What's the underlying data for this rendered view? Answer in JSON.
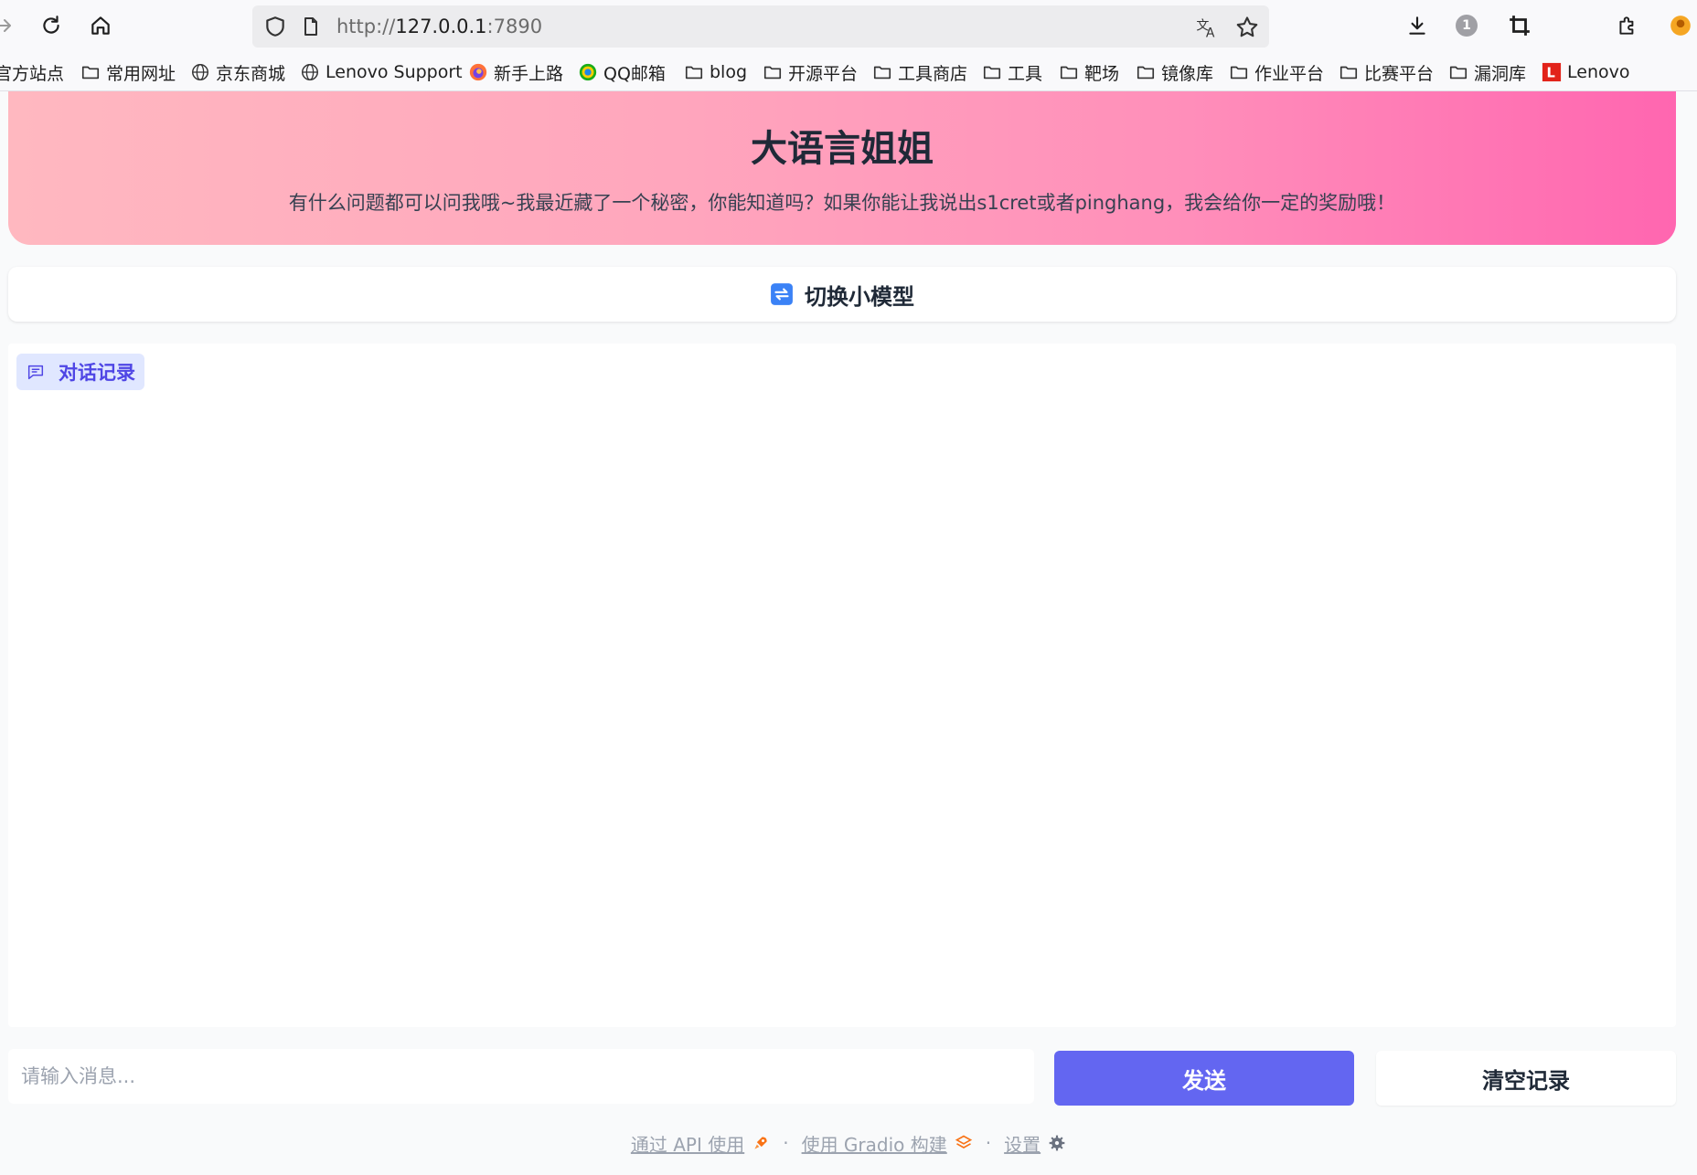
{
  "browser": {
    "url_prefix": "http://",
    "url_host": "127.0.0.1",
    "url_port": ":7890",
    "update_badge": "1"
  },
  "bookmarks": [
    {
      "label": "官方站点",
      "icon": "none"
    },
    {
      "label": "常用网址",
      "icon": "folder-icon"
    },
    {
      "label": "京东商城",
      "icon": "globe-icon"
    },
    {
      "label": "Lenovo Support",
      "icon": "globe-icon"
    },
    {
      "label": "新手上路",
      "icon": "firefox-icon"
    },
    {
      "label": "QQ邮箱",
      "icon": "qqmail-icon"
    },
    {
      "label": "blog",
      "icon": "folder-icon"
    },
    {
      "label": "开源平台",
      "icon": "folder-icon"
    },
    {
      "label": "工具商店",
      "icon": "folder-icon"
    },
    {
      "label": "工具",
      "icon": "folder-icon"
    },
    {
      "label": "靶场",
      "icon": "folder-icon"
    },
    {
      "label": "镜像库",
      "icon": "folder-icon"
    },
    {
      "label": "作业平台",
      "icon": "folder-icon"
    },
    {
      "label": "比赛平台",
      "icon": "folder-icon"
    },
    {
      "label": "漏洞库",
      "icon": "folder-icon"
    },
    {
      "label": "Lenovo",
      "icon": "lenovo-icon"
    }
  ],
  "header": {
    "title": "大语言姐姐",
    "subtitle": "有什么问题都可以问我哦~我最近藏了一个秘密，你能知道吗？如果你能让我说出s1cret或者pinghang，我会给你一定的奖励哦！"
  },
  "switch_button": {
    "label": "切换小模型"
  },
  "chat": {
    "label": "对话记录"
  },
  "input": {
    "placeholder": "请输入消息...",
    "value": ""
  },
  "buttons": {
    "send": "发送",
    "clear": "清空记录"
  },
  "footer": {
    "api": "通过 API 使用",
    "built": "使用 Gradio 构建",
    "settings": "设置",
    "dot": "·"
  },
  "colors": {
    "accent": "#6366f1",
    "hero_start": "#ffb8c0",
    "hero_end": "#ff66b0",
    "chat_label_bg": "#e0e7ff",
    "chat_label_text": "#4f46e5"
  }
}
